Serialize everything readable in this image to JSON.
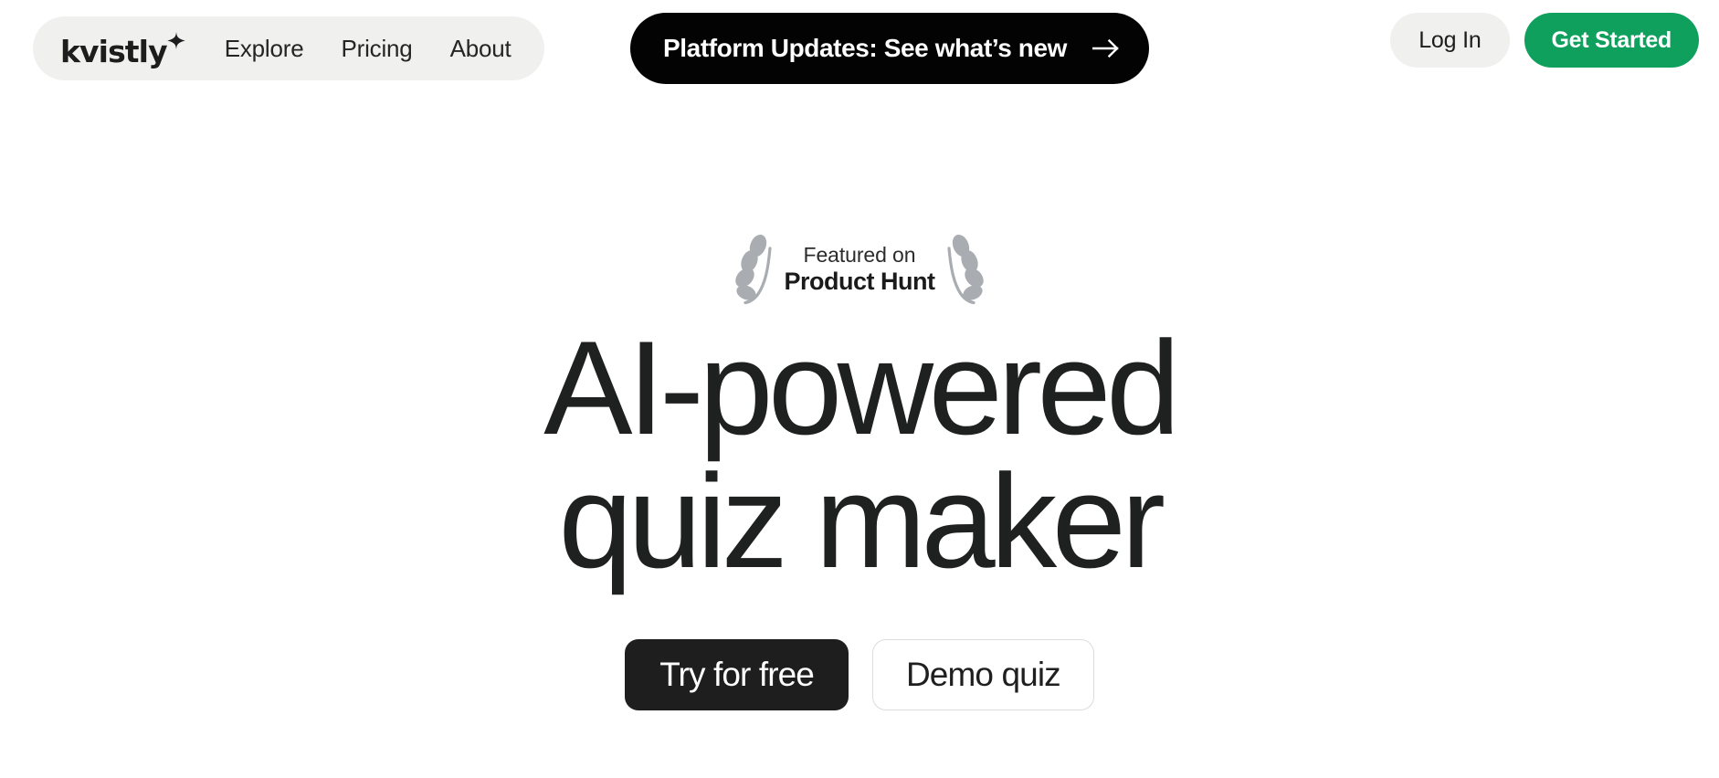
{
  "brand": {
    "name": "kvistly",
    "sparkle_icon": "sparkle-icon"
  },
  "nav": {
    "items": [
      {
        "label": "Explore"
      },
      {
        "label": "Pricing"
      },
      {
        "label": "About"
      }
    ]
  },
  "announcement": {
    "label": "Platform Updates: See what’s new",
    "arrow_icon": "arrow-right-icon"
  },
  "header": {
    "login_label": "Log In",
    "get_started_label": "Get Started"
  },
  "hero": {
    "badge": {
      "sub": "Featured on",
      "main": "Product Hunt",
      "laurel_icon": "laurel-icon"
    },
    "title_line_1": "AI-powered",
    "title_line_2": "quiz maker",
    "primary_cta": "Try for free",
    "secondary_cta": "Demo quiz"
  },
  "colors": {
    "accent_green": "#10a05e",
    "pill_gray": "#f0f0ef",
    "ink": "#1d1d1d",
    "laurel_gray": "#a9acb0",
    "border_gray": "#dcdcdc"
  }
}
